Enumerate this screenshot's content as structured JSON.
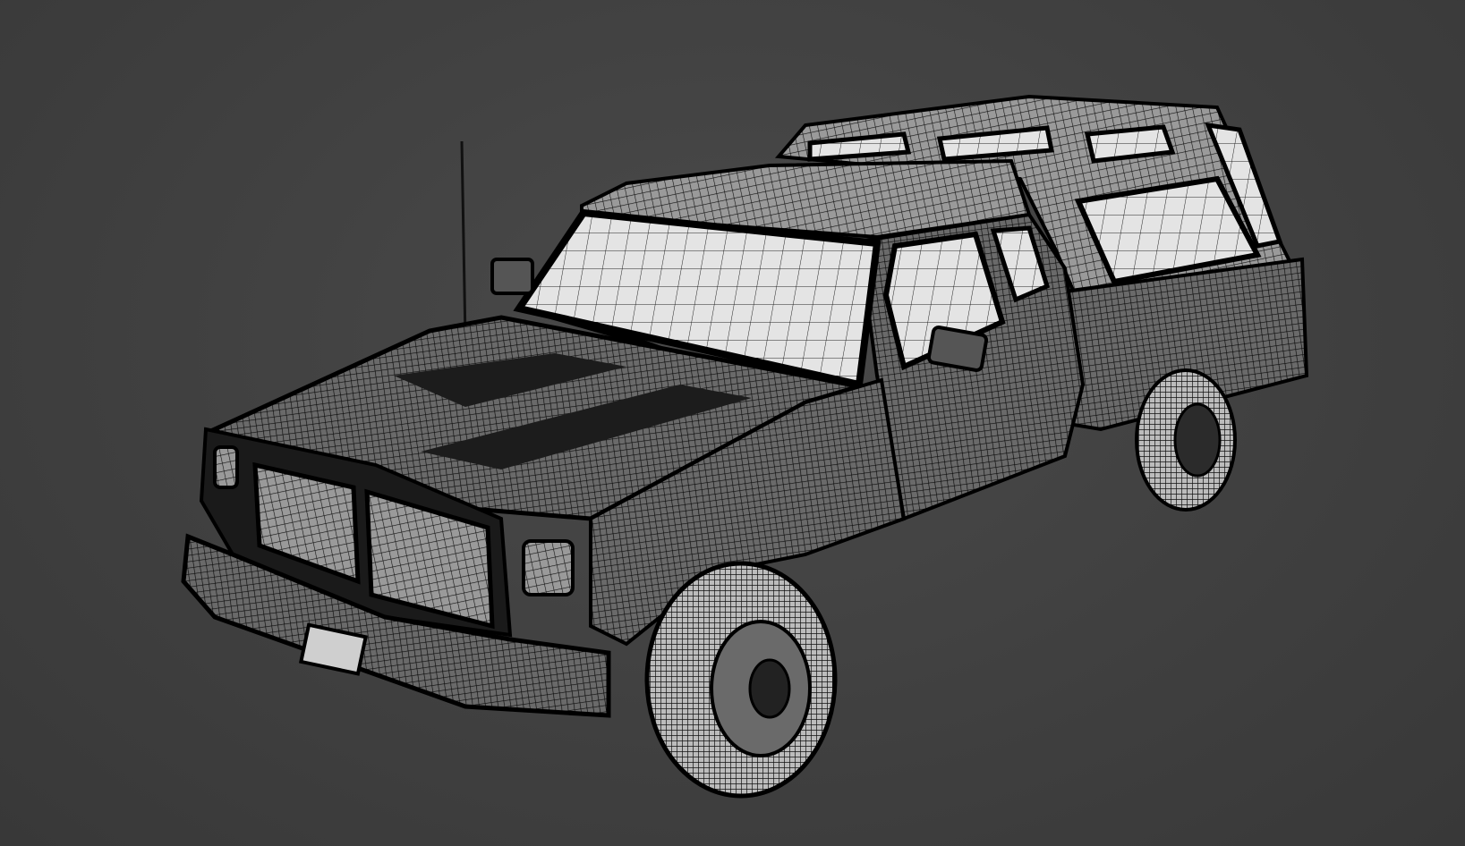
{
  "scene": {
    "subject": "pickup-truck-wireframe",
    "colors": {
      "background": "#424242",
      "body": "#2a2a2a",
      "glass": "#d8d8d8",
      "wire": "#000000",
      "highlight": "#bdbdbd"
    }
  }
}
